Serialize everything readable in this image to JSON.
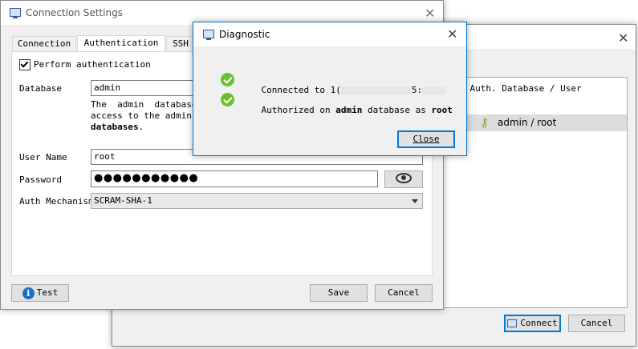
{
  "background_window": {
    "column_header": "es  Auth. Database / User",
    "selected_row": "admin / root",
    "connect_label": "Connect",
    "cancel_label": "Cancel"
  },
  "connection_settings": {
    "title": "Connection Settings",
    "tabs": [
      "Connection",
      "Authentication",
      "SSH"
    ],
    "perform_auth_label": "Perform authentication",
    "database_label": "Database",
    "database_value": "admin",
    "database_help_1": "The  admin  database",
    "database_help_2": "access to the admin da",
    "database_help_3": "databases",
    "database_help_3_suffix": ".",
    "user_name_label": "User Name",
    "user_name_value": "root",
    "password_label": "Password",
    "password_mask": "●●●●●●●●●●●",
    "auth_mechanism_label": "Auth Mechanism",
    "auth_mechanism_value": "SCRAM-SHA-1",
    "test_label": "Test",
    "save_label": "Save",
    "cancel_label": "Cancel"
  },
  "diagnostic": {
    "title": "Diagnostic",
    "connected_prefix": "Connected to ",
    "connected_host_start": "1(",
    "connected_host_mid": "5:",
    "authorized_prefix": "Authorized on ",
    "authorized_db": "admin",
    "authorized_mid": " database as ",
    "authorized_user": "root",
    "close_label": "Close"
  },
  "colors": {
    "accent": "#0078d7",
    "success": "#6cbf2f",
    "selection": "#dcdcdc"
  }
}
